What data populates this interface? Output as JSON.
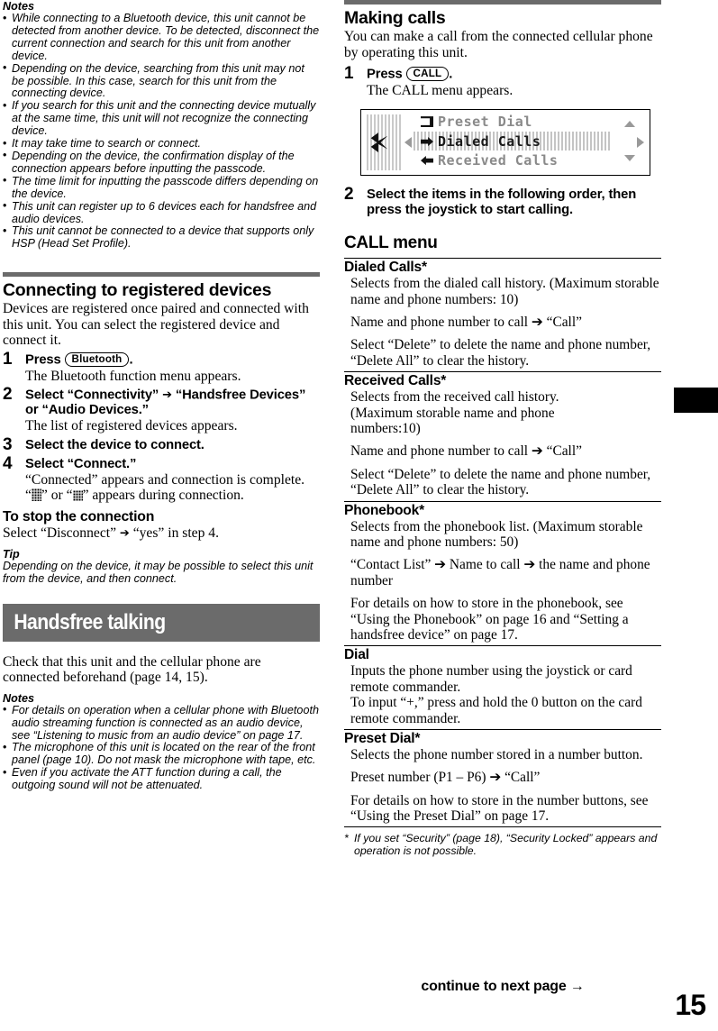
{
  "page": {
    "number": "15",
    "continue_text": "continue to next page",
    "continue_arrow": "→",
    "tab_marker": "black-edge-tab",
    "rule_color": "#6b6b6b",
    "banner_color": "#6b6b6b"
  },
  "left": {
    "notes_top": {
      "heading": "Notes",
      "items": [
        "While connecting to a Bluetooth device, this unit cannot be detected from another device. To be detected, disconnect the current connection and search for this unit from another device.",
        "Depending on the device, searching from this unit may not be possible. In this case, search for this unit from the connecting device.",
        "If you search for this unit and the connecting device mutually at the same time, this unit will not recognize the connecting device.",
        "It may take time to search or connect.",
        "Depending on the device, the confirmation display of the connection appears before inputting the passcode.",
        "The time limit for inputting the passcode differs depending on the device.",
        "This unit can register up to 6 devices each for handsfree and audio devices.",
        "This unit cannot be connected to a device that supports only HSP (Head Set Profile)."
      ]
    },
    "section": {
      "heading": "Connecting to registered devices",
      "intro": "Devices are registered once paired and connected with this unit. You can select the registered device and connect it."
    },
    "steps": [
      {
        "num": "1",
        "title_pre": "Press",
        "button": "Bluetooth",
        "title_post": ".",
        "sub": "The Bluetooth function menu appears."
      },
      {
        "num": "2",
        "title_pre": "Select “Connectivity”",
        "arrow": "➔",
        "title_post": "“Handsfree Devices” or “Audio Devices.”",
        "sub": "The list of registered devices appears."
      },
      {
        "num": "3",
        "title_pre": "Select the device to connect.",
        "sub": ""
      },
      {
        "num": "4",
        "title_pre": "Select “Connect.”",
        "sub": "“Connected” appears and connection is complete.",
        "sub2_pre": "“",
        "sub2_mid": "” or “",
        "sub2_post": "” appears during connection."
      }
    ],
    "stop": {
      "heading": "To stop the connection",
      "body_pre": "Select “Disconnect”",
      "arrow": "➔",
      "body_post": "“yes” in step 4."
    },
    "tip": {
      "heading": "Tip",
      "body": "Depending on the device, it may be possible to select this unit from the device, and then connect."
    },
    "banner": "Handsfree talking",
    "banner_body": "Check that this unit and the cellular phone are connected beforehand (page 14, 15).",
    "notes_bottom": {
      "heading": "Notes",
      "items": [
        "For details on operation when a cellular phone with Bluetooth audio streaming function is connected as an audio device, see “Listening to music from an audio device” on page 17.",
        "The microphone of this unit is located on the rear of the front panel (page 10). Do not mask the microphone with tape, etc.",
        "Even if you activate the ATT function during a call, the outgoing sound will not be attenuated."
      ]
    }
  },
  "right": {
    "section": {
      "heading": "Making calls",
      "intro": "You can make a call from the connected cellular phone by operating this unit."
    },
    "step1": {
      "num": "1",
      "title_pre": "Press",
      "button": "CALL",
      "title_post": ".",
      "sub": "The CALL menu appears."
    },
    "lcd": {
      "rows": [
        "Preset Dial",
        "Dialed Calls",
        "Received Calls"
      ],
      "selected_index": 1
    },
    "step2": {
      "num": "2",
      "title": "Select the items in the following order, then press the joystick to start calling."
    },
    "call_menu": {
      "heading": "CALL menu",
      "entries": [
        {
          "name": "Dialed Calls",
          "star": "*",
          "paragraphs": [
            "Selects from the dialed call history. (Maximum storable name and phone numbers: 10)",
            "Name and phone number to call ➔ “Call”",
            "Select “Delete” to delete the name and phone number, “Delete All” to clear the history."
          ]
        },
        {
          "name": "Received Calls",
          "star": "*",
          "paragraphs": [
            "Selects from the received call history. (Maximum storable name and phone numbers:10)",
            "Name and phone number to call ➔ “Call”",
            "Select “Delete” to delete the name and phone number, “Delete All” to clear the history."
          ]
        },
        {
          "name": "Phonebook",
          "star": "*",
          "paragraphs": [
            "Selects from the phonebook list. (Maximum storable name and phone numbers: 50)",
            "“Contact List” ➔ Name to call ➔ the name and phone number",
            "For details on how to store in the phonebook, see “Using the Phonebook” on page 16 and “Setting a handsfree device” on page 17."
          ]
        },
        {
          "name": "Dial",
          "star": "",
          "paragraphs": [
            "Inputs the phone number using the joystick or card remote commander.\nTo input “+,” press and hold the 0 button on the card remote commander."
          ]
        },
        {
          "name": "Preset Dial",
          "star": "*",
          "paragraphs": [
            "Selects the phone number stored in a number button.",
            "Preset number (P1 – P6) ➔ “Call”",
            "For details on how to store in the number buttons, see “Using the Preset Dial” on page 17."
          ]
        }
      ]
    },
    "footnote": {
      "marker": "*",
      "text": "If you set “Security” (page 18), “Security Locked” appears and operation is not possible."
    }
  }
}
